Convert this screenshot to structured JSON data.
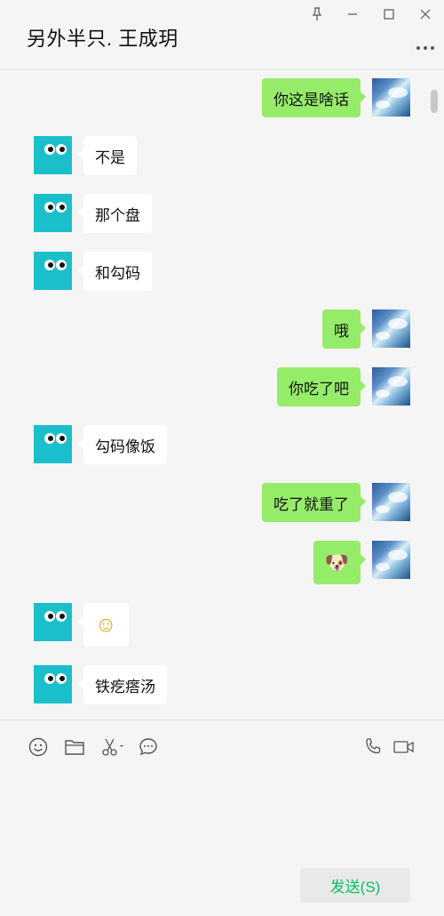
{
  "header": {
    "title": "另外半只. 王成玥"
  },
  "window_controls": {
    "pin": "pin-icon",
    "minimize": "minimize-icon",
    "maximize": "maximize-icon",
    "close": "close-icon",
    "more": "more-dots-icon"
  },
  "messages": [
    {
      "side": "right",
      "text": "你这是啥话"
    },
    {
      "side": "left",
      "text": "不是"
    },
    {
      "side": "left",
      "text": "那个盘"
    },
    {
      "side": "left",
      "text": "和勾码"
    },
    {
      "side": "right",
      "text": "哦"
    },
    {
      "side": "right",
      "text": "你吃了吧"
    },
    {
      "side": "left",
      "text": "勾码像饭"
    },
    {
      "side": "right",
      "text": "吃了就重了"
    },
    {
      "side": "right",
      "text": "🐶"
    },
    {
      "side": "left",
      "text": "☺"
    },
    {
      "side": "left",
      "text": "铁疙瘩汤"
    }
  ],
  "toolbar": {
    "emoji": "emoji-icon",
    "file": "folder-icon",
    "screenshot": "scissors-icon",
    "chat_history": "chat-bubble-icon",
    "voice_call": "phone-icon",
    "video_call": "video-icon"
  },
  "composer": {
    "send_label": "发送(S)"
  },
  "colors": {
    "my_bubble": "#95ec69",
    "their_bubble": "#ffffff",
    "background": "#f5f5f5",
    "send_text": "#07c160",
    "avatar_teal": "#1bbfcc"
  }
}
